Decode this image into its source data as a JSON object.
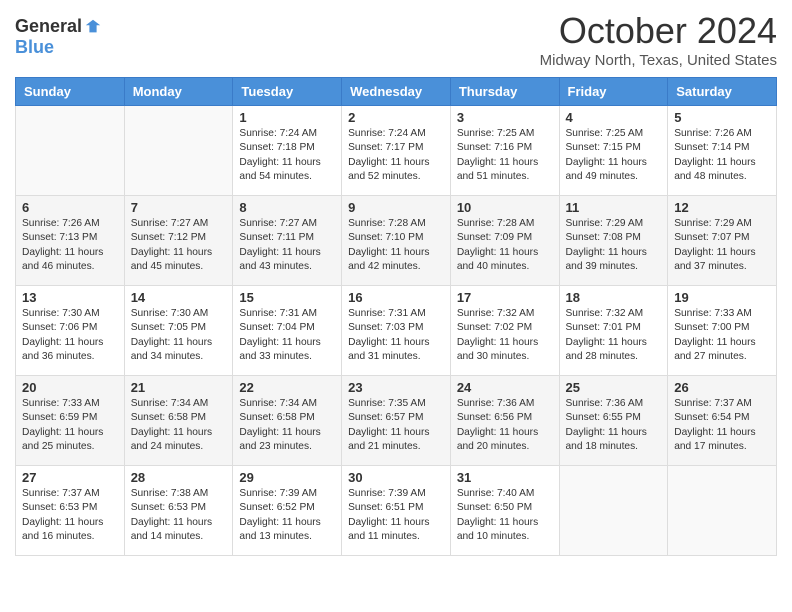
{
  "header": {
    "logo_general": "General",
    "logo_blue": "Blue",
    "month_title": "October 2024",
    "location": "Midway North, Texas, United States"
  },
  "days_of_week": [
    "Sunday",
    "Monday",
    "Tuesday",
    "Wednesday",
    "Thursday",
    "Friday",
    "Saturday"
  ],
  "weeks": [
    [
      {
        "day": "",
        "sunrise": "",
        "sunset": "",
        "daylight": ""
      },
      {
        "day": "",
        "sunrise": "",
        "sunset": "",
        "daylight": ""
      },
      {
        "day": "1",
        "sunrise": "Sunrise: 7:24 AM",
        "sunset": "Sunset: 7:18 PM",
        "daylight": "Daylight: 11 hours and 54 minutes."
      },
      {
        "day": "2",
        "sunrise": "Sunrise: 7:24 AM",
        "sunset": "Sunset: 7:17 PM",
        "daylight": "Daylight: 11 hours and 52 minutes."
      },
      {
        "day": "3",
        "sunrise": "Sunrise: 7:25 AM",
        "sunset": "Sunset: 7:16 PM",
        "daylight": "Daylight: 11 hours and 51 minutes."
      },
      {
        "day": "4",
        "sunrise": "Sunrise: 7:25 AM",
        "sunset": "Sunset: 7:15 PM",
        "daylight": "Daylight: 11 hours and 49 minutes."
      },
      {
        "day": "5",
        "sunrise": "Sunrise: 7:26 AM",
        "sunset": "Sunset: 7:14 PM",
        "daylight": "Daylight: 11 hours and 48 minutes."
      }
    ],
    [
      {
        "day": "6",
        "sunrise": "Sunrise: 7:26 AM",
        "sunset": "Sunset: 7:13 PM",
        "daylight": "Daylight: 11 hours and 46 minutes."
      },
      {
        "day": "7",
        "sunrise": "Sunrise: 7:27 AM",
        "sunset": "Sunset: 7:12 PM",
        "daylight": "Daylight: 11 hours and 45 minutes."
      },
      {
        "day": "8",
        "sunrise": "Sunrise: 7:27 AM",
        "sunset": "Sunset: 7:11 PM",
        "daylight": "Daylight: 11 hours and 43 minutes."
      },
      {
        "day": "9",
        "sunrise": "Sunrise: 7:28 AM",
        "sunset": "Sunset: 7:10 PM",
        "daylight": "Daylight: 11 hours and 42 minutes."
      },
      {
        "day": "10",
        "sunrise": "Sunrise: 7:28 AM",
        "sunset": "Sunset: 7:09 PM",
        "daylight": "Daylight: 11 hours and 40 minutes."
      },
      {
        "day": "11",
        "sunrise": "Sunrise: 7:29 AM",
        "sunset": "Sunset: 7:08 PM",
        "daylight": "Daylight: 11 hours and 39 minutes."
      },
      {
        "day": "12",
        "sunrise": "Sunrise: 7:29 AM",
        "sunset": "Sunset: 7:07 PM",
        "daylight": "Daylight: 11 hours and 37 minutes."
      }
    ],
    [
      {
        "day": "13",
        "sunrise": "Sunrise: 7:30 AM",
        "sunset": "Sunset: 7:06 PM",
        "daylight": "Daylight: 11 hours and 36 minutes."
      },
      {
        "day": "14",
        "sunrise": "Sunrise: 7:30 AM",
        "sunset": "Sunset: 7:05 PM",
        "daylight": "Daylight: 11 hours and 34 minutes."
      },
      {
        "day": "15",
        "sunrise": "Sunrise: 7:31 AM",
        "sunset": "Sunset: 7:04 PM",
        "daylight": "Daylight: 11 hours and 33 minutes."
      },
      {
        "day": "16",
        "sunrise": "Sunrise: 7:31 AM",
        "sunset": "Sunset: 7:03 PM",
        "daylight": "Daylight: 11 hours and 31 minutes."
      },
      {
        "day": "17",
        "sunrise": "Sunrise: 7:32 AM",
        "sunset": "Sunset: 7:02 PM",
        "daylight": "Daylight: 11 hours and 30 minutes."
      },
      {
        "day": "18",
        "sunrise": "Sunrise: 7:32 AM",
        "sunset": "Sunset: 7:01 PM",
        "daylight": "Daylight: 11 hours and 28 minutes."
      },
      {
        "day": "19",
        "sunrise": "Sunrise: 7:33 AM",
        "sunset": "Sunset: 7:00 PM",
        "daylight": "Daylight: 11 hours and 27 minutes."
      }
    ],
    [
      {
        "day": "20",
        "sunrise": "Sunrise: 7:33 AM",
        "sunset": "Sunset: 6:59 PM",
        "daylight": "Daylight: 11 hours and 25 minutes."
      },
      {
        "day": "21",
        "sunrise": "Sunrise: 7:34 AM",
        "sunset": "Sunset: 6:58 PM",
        "daylight": "Daylight: 11 hours and 24 minutes."
      },
      {
        "day": "22",
        "sunrise": "Sunrise: 7:34 AM",
        "sunset": "Sunset: 6:58 PM",
        "daylight": "Daylight: 11 hours and 23 minutes."
      },
      {
        "day": "23",
        "sunrise": "Sunrise: 7:35 AM",
        "sunset": "Sunset: 6:57 PM",
        "daylight": "Daylight: 11 hours and 21 minutes."
      },
      {
        "day": "24",
        "sunrise": "Sunrise: 7:36 AM",
        "sunset": "Sunset: 6:56 PM",
        "daylight": "Daylight: 11 hours and 20 minutes."
      },
      {
        "day": "25",
        "sunrise": "Sunrise: 7:36 AM",
        "sunset": "Sunset: 6:55 PM",
        "daylight": "Daylight: 11 hours and 18 minutes."
      },
      {
        "day": "26",
        "sunrise": "Sunrise: 7:37 AM",
        "sunset": "Sunset: 6:54 PM",
        "daylight": "Daylight: 11 hours and 17 minutes."
      }
    ],
    [
      {
        "day": "27",
        "sunrise": "Sunrise: 7:37 AM",
        "sunset": "Sunset: 6:53 PM",
        "daylight": "Daylight: 11 hours and 16 minutes."
      },
      {
        "day": "28",
        "sunrise": "Sunrise: 7:38 AM",
        "sunset": "Sunset: 6:53 PM",
        "daylight": "Daylight: 11 hours and 14 minutes."
      },
      {
        "day": "29",
        "sunrise": "Sunrise: 7:39 AM",
        "sunset": "Sunset: 6:52 PM",
        "daylight": "Daylight: 11 hours and 13 minutes."
      },
      {
        "day": "30",
        "sunrise": "Sunrise: 7:39 AM",
        "sunset": "Sunset: 6:51 PM",
        "daylight": "Daylight: 11 hours and 11 minutes."
      },
      {
        "day": "31",
        "sunrise": "Sunrise: 7:40 AM",
        "sunset": "Sunset: 6:50 PM",
        "daylight": "Daylight: 11 hours and 10 minutes."
      },
      {
        "day": "",
        "sunrise": "",
        "sunset": "",
        "daylight": ""
      },
      {
        "day": "",
        "sunrise": "",
        "sunset": "",
        "daylight": ""
      }
    ]
  ]
}
